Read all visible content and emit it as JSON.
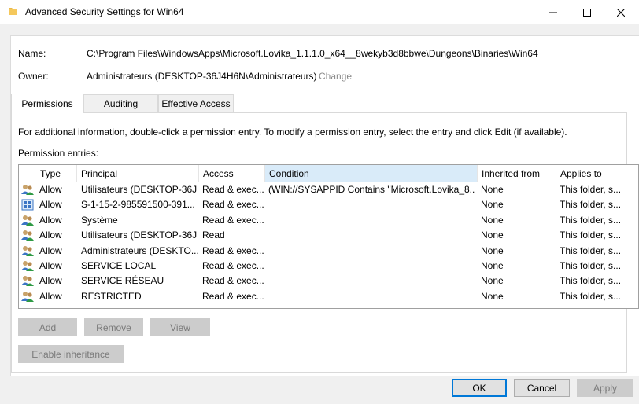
{
  "window": {
    "title": "Advanced Security Settings for Win64",
    "icon": "folder-icon",
    "controls": [
      "minimize-icon",
      "maximize-icon",
      "close-icon"
    ]
  },
  "fields": {
    "name_label": "Name:",
    "name_value": "C:\\Program Files\\WindowsApps\\Microsoft.Lovika_1.1.1.0_x64__8wekyb3d8bbwe\\Dungeons\\Binaries\\Win64",
    "owner_label": "Owner:",
    "owner_value": "Administrateurs (DESKTOP-36J4H6N\\Administrateurs)",
    "change_link": "Change"
  },
  "tabs": [
    {
      "label": "Permissions",
      "active": true
    },
    {
      "label": "Auditing",
      "active": false
    },
    {
      "label": "Effective Access",
      "active": false
    }
  ],
  "info_text": "For additional information, double-click a permission entry. To modify a permission entry, select the entry and click Edit (if available).",
  "entries_label": "Permission entries:",
  "table": {
    "columns": [
      "Type",
      "Principal",
      "Access",
      "Condition",
      "Inherited from",
      "Applies to"
    ],
    "sorted_column": "Condition",
    "rows": [
      {
        "icon": "users-icon",
        "type": "Allow",
        "principal": "Utilisateurs (DESKTOP-36J...",
        "access": "Read & exec...",
        "condition": "(WIN://SYSAPPID Contains \"Microsoft.Lovika_8...",
        "inherited": "None",
        "applies": "This folder, s..."
      },
      {
        "icon": "package-sid-icon",
        "type": "Allow",
        "principal": "S-1-15-2-985591500-391...",
        "access": "Read & exec...",
        "condition": "",
        "inherited": "None",
        "applies": "This folder, s..."
      },
      {
        "icon": "users-icon",
        "type": "Allow",
        "principal": "Système",
        "access": "Read & exec...",
        "condition": "",
        "inherited": "None",
        "applies": "This folder, s..."
      },
      {
        "icon": "users-icon",
        "type": "Allow",
        "principal": "Utilisateurs (DESKTOP-36J...",
        "access": "Read",
        "condition": "",
        "inherited": "None",
        "applies": "This folder, s..."
      },
      {
        "icon": "users-icon",
        "type": "Allow",
        "principal": "Administrateurs (DESKTO...",
        "access": "Read & exec...",
        "condition": "",
        "inherited": "None",
        "applies": "This folder, s..."
      },
      {
        "icon": "users-icon",
        "type": "Allow",
        "principal": "SERVICE LOCAL",
        "access": "Read & exec...",
        "condition": "",
        "inherited": "None",
        "applies": "This folder, s..."
      },
      {
        "icon": "users-icon",
        "type": "Allow",
        "principal": "SERVICE RÉSEAU",
        "access": "Read & exec...",
        "condition": "",
        "inherited": "None",
        "applies": "This folder, s..."
      },
      {
        "icon": "users-icon",
        "type": "Allow",
        "principal": "RESTRICTED",
        "access": "Read & exec...",
        "condition": "",
        "inherited": "None",
        "applies": "This folder, s..."
      }
    ]
  },
  "buttons": {
    "add": "Add",
    "remove": "Remove",
    "view": "View",
    "enable_inheritance": "Enable inheritance",
    "ok": "OK",
    "cancel": "Cancel",
    "apply": "Apply"
  },
  "colors": {
    "accent": "#0078d7",
    "sorted_header": "#d9ebf9",
    "link": "#8a8a8a"
  }
}
